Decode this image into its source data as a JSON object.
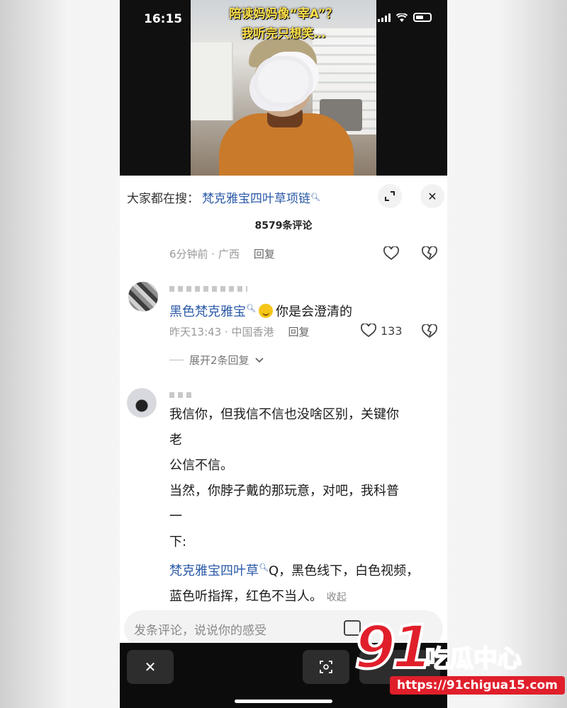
{
  "status": {
    "time": "16:15"
  },
  "video": {
    "caption_line1": "陪读妈妈像“宰A”？",
    "caption_line2": "我听完只想笑…"
  },
  "sheet": {
    "search_prefix": "大家都在搜：",
    "search_term": "梵克雅宝四叶草项链",
    "comment_count": "8579条评论"
  },
  "comments": [
    {
      "time": "6分钟前 · 广西",
      "reply": "回复"
    },
    {
      "link": "黑色梵克雅宝",
      "text": "你是会澄清的",
      "time": "昨天13:43 · 中国香港",
      "reply": "回复",
      "likes": "133",
      "expand": "展开2条回复"
    },
    {
      "line1": "我信你，但我信不信也没啥区别，关键你",
      "line2": "老",
      "line3": "公信不信。",
      "line4": "当然，你脖子戴的那玩意，对吧，我科普",
      "line5": "一",
      "line6": "下:",
      "line7_link": "梵克雅宝四叶草",
      "line7_rest": "Q，黑色线下，白色视频，",
      "line8": "蓝色听指挥，红色不当人。",
      "collapse": "收起"
    }
  ],
  "input": {
    "placeholder": "发条评论，说说你的感受"
  },
  "watermark": {
    "num": "91",
    "text": "吃瓜中心",
    "url": "https://91chigua15.com"
  }
}
